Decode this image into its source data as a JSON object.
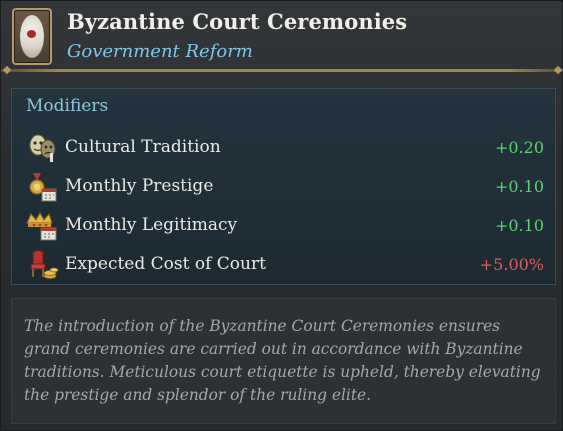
{
  "header": {
    "title": "Byzantine Court Ceremonies",
    "subtitle": "Government Reform",
    "portrait_icon": "government-reform-portrait-icon"
  },
  "modifiers": {
    "title": "Modifiers",
    "items": [
      {
        "icon": "theater-masks-icon",
        "label": "Cultural Tradition",
        "value": "+0.20",
        "sentiment": "good"
      },
      {
        "icon": "medal-calendar-icon",
        "label": "Monthly Prestige",
        "value": "+0.10",
        "sentiment": "good"
      },
      {
        "icon": "crown-calendar-icon",
        "label": "Monthly Legitimacy",
        "value": "+0.10",
        "sentiment": "good"
      },
      {
        "icon": "throne-coins-icon",
        "label": "Expected Cost of Court",
        "value": "+5.00%",
        "sentiment": "bad"
      }
    ]
  },
  "description": {
    "text": "The introduction of the Byzantine Court Ceremonies ensures grand ceremonies are carried out in accordance with Byzantine traditions. Meticulous court etiquette is upheld, thereby elevating the prestige and splendor of the ruling elite."
  },
  "colors": {
    "positive": "#5fd173",
    "negative": "#e4575b",
    "subtitle": "#7ec7e8",
    "section_title": "#8ec6e0"
  }
}
